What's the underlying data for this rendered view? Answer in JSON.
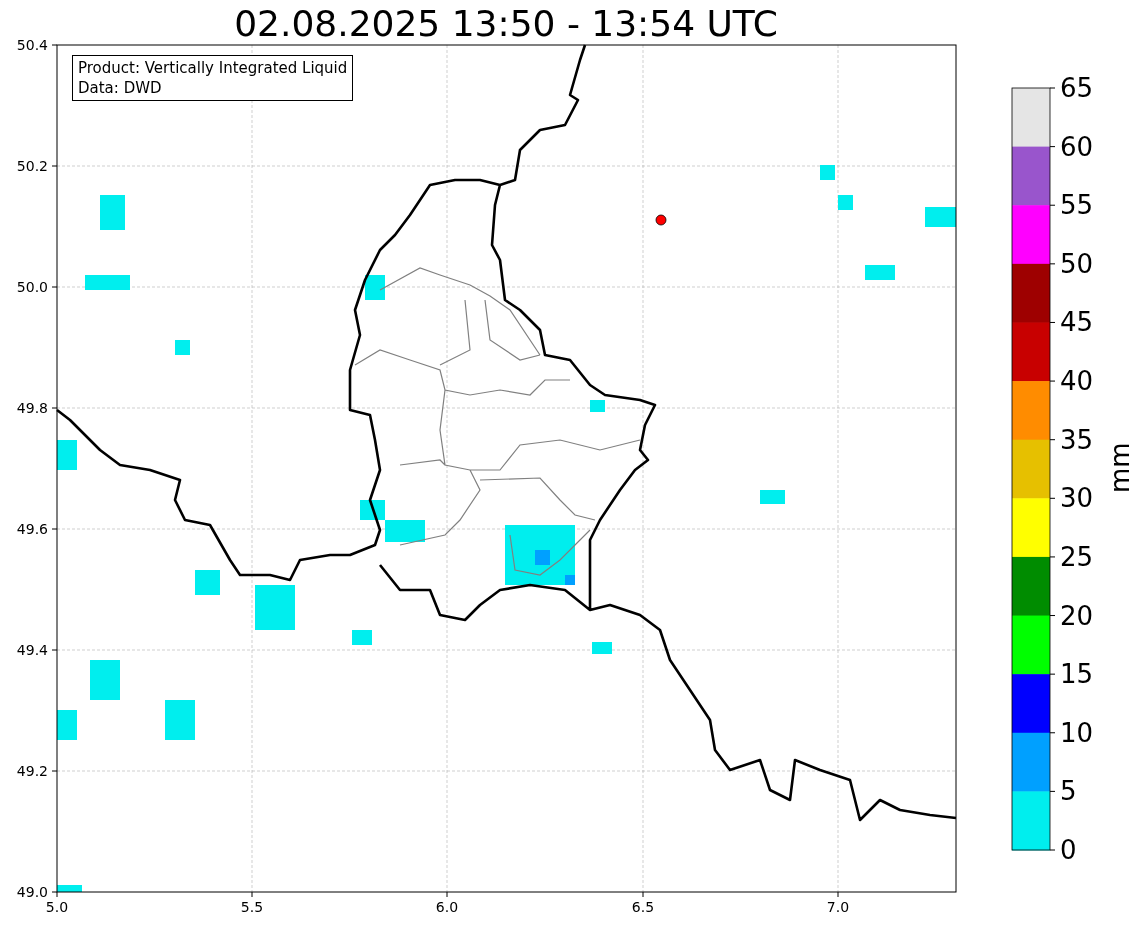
{
  "title": "02.08.2025 13:50 - 13:54 UTC",
  "info_box": {
    "lines": [
      "Product: Vertically Integrated Liquid",
      "Data: DWD"
    ]
  },
  "x_axis": {
    "ticks": [
      "5.0",
      "5.5",
      "6.0",
      "6.5",
      "7.0"
    ]
  },
  "y_axis": {
    "ticks": [
      "50.4",
      "50.2",
      "50.0",
      "49.8",
      "49.6",
      "49.4",
      "49.2",
      "49.0"
    ]
  },
  "colorbar": {
    "unit": "mm",
    "segments": [
      {
        "color": "#e5e5e5"
      },
      {
        "color": "#9955cc"
      },
      {
        "color": "#ff00ff"
      },
      {
        "color": "#9e0000"
      },
      {
        "color": "#c80000"
      },
      {
        "color": "#ff8c00"
      },
      {
        "color": "#e6c000"
      },
      {
        "color": "#ffff00"
      },
      {
        "color": "#008c00"
      },
      {
        "color": "#00ff00"
      },
      {
        "color": "#0000ff"
      },
      {
        "color": "#00a0ff"
      },
      {
        "color": "#00eeee"
      }
    ],
    "ticks": [
      "65",
      "60",
      "55",
      "50",
      "45",
      "40",
      "35",
      "30",
      "25",
      "20",
      "15",
      "10",
      "5",
      "0"
    ]
  }
}
